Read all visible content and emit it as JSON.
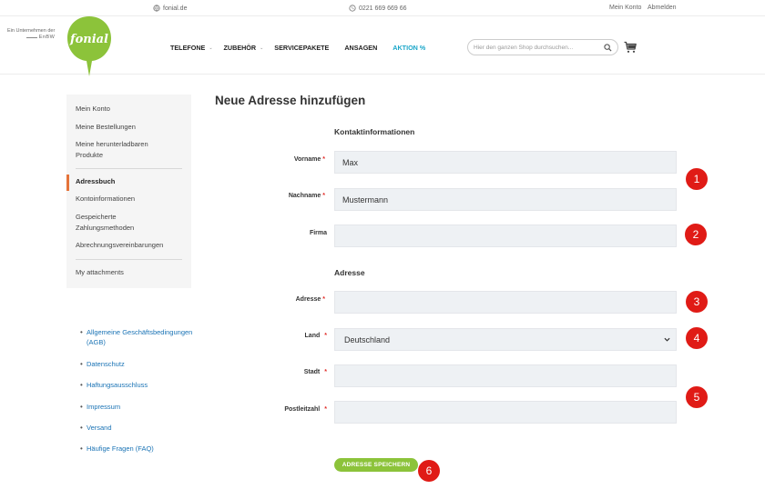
{
  "topbar": {
    "site": "fonial.de",
    "phone": "0221 669 669 66",
    "my_account": "Mein Konto",
    "logout": "Abmelden"
  },
  "header": {
    "enbw_line1": "Ein Unternehmen der",
    "enbw_line2": "EnBW",
    "logo_text": "fonial",
    "nav": [
      {
        "label": "TELEFONE",
        "has_caret": true
      },
      {
        "label": "ZUBEHÖR",
        "has_caret": true
      },
      {
        "label": "SERVICEPAKETE",
        "has_caret": false
      },
      {
        "label": "ANSAGEN",
        "has_caret": false
      },
      {
        "label": "AKTION %",
        "has_caret": false
      }
    ],
    "search_placeholder": "Hier den ganzen Shop durchsuchen..."
  },
  "sidebar": {
    "items": [
      {
        "label": "Mein Konto"
      },
      {
        "label": "Meine Bestellungen"
      },
      {
        "label": "Meine herunterladbaren Produkte"
      },
      {
        "label": "Adressbuch",
        "active": true
      },
      {
        "label": "Kontoinformationen"
      },
      {
        "label": "Gespeicherte Zahlungsmethoden"
      },
      {
        "label": "Abrechnungsvereinbarungen"
      },
      {
        "label": "My attachments"
      }
    ]
  },
  "links": [
    {
      "label": "Allgemeine Geschäftsbedingungen (AGB)"
    },
    {
      "label": "Datenschutz"
    },
    {
      "label": "Haftungsausschluss"
    },
    {
      "label": "Impressum"
    },
    {
      "label": "Versand"
    },
    {
      "label": "Häufige Fragen (FAQ)"
    }
  ],
  "main": {
    "title": "Neue Adresse hinzufügen",
    "section_contact": "Kontaktinformationen",
    "section_address": "Adresse",
    "required_mark": "*",
    "fields": {
      "vorname": {
        "label": "Vorname",
        "value": "Max",
        "required": true
      },
      "nachname": {
        "label": "Nachname",
        "value": "Mustermann",
        "required": true
      },
      "firma": {
        "label": "Firma",
        "value": "",
        "required": false
      },
      "adresse": {
        "label": "Adresse",
        "value": "",
        "required": true
      },
      "land": {
        "label": "Land",
        "value": "Deutschland",
        "required": true
      },
      "stadt": {
        "label": "Stadt",
        "value": "",
        "required": true
      },
      "plz": {
        "label": "Postleitzahl",
        "value": "",
        "required": true
      }
    },
    "save_label": "ADRESSE SPEICHERN"
  },
  "markers": [
    "1",
    "2",
    "3",
    "4",
    "5",
    "6"
  ],
  "colors": {
    "brand_green": "#8cc33a",
    "accent_orange": "#e5733a",
    "link_blue": "#1a73b5",
    "aktion_blue": "#1aa6c9",
    "marker_red": "#e01b16",
    "required_red": "#e02b27"
  },
  "icons": {
    "site": "globe-icon",
    "phone": "phone-icon",
    "search": "search-icon",
    "cart": "cart-icon",
    "select": "chevron-down-icon"
  }
}
